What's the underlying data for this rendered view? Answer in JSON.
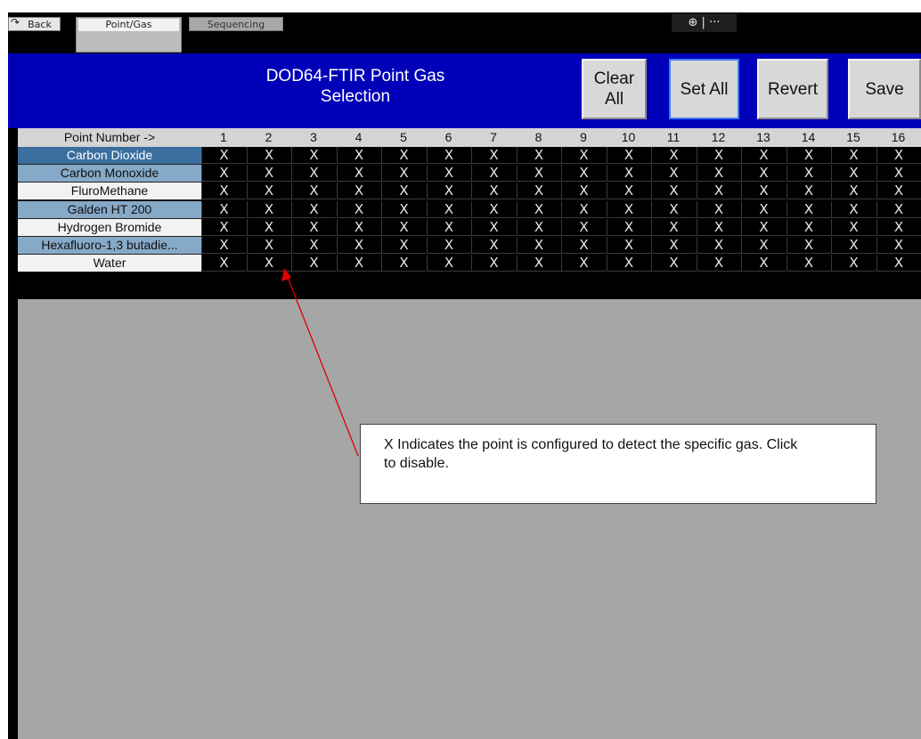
{
  "tabs": {
    "back": "Back",
    "point_gas": "Point/Gas",
    "sequencing": "Sequencing"
  },
  "zoom_controls": {
    "zoom_icon": "zoom-in-icon",
    "separator": "|",
    "more": "···"
  },
  "header": {
    "title_line1": "DOD64-FTIR Point Gas",
    "title_line2": "Selection",
    "clear_line1": "Clear",
    "clear_line2": "All",
    "set_all": "Set All",
    "revert": "Revert",
    "save": "Save",
    "background_color": "#0000b8"
  },
  "grid": {
    "header_label": "Point Number ->",
    "points": [
      "1",
      "2",
      "3",
      "4",
      "5",
      "6",
      "7",
      "8",
      "9",
      "10",
      "11",
      "12",
      "13",
      "14",
      "15",
      "16"
    ],
    "rows": [
      {
        "name": "Carbon Dioxide",
        "bg": "#3a6f9e",
        "fg": "#ffffff"
      },
      {
        "name": "Carbon Monoxide",
        "bg": "#86a9c8",
        "fg": "#111111"
      },
      {
        "name": "FluroMethane",
        "bg": "#f2f2f2",
        "fg": "#111111"
      },
      {
        "name": "Galden HT 200",
        "bg": "#86a9c8",
        "fg": "#111111"
      },
      {
        "name": "Hydrogen Bromide",
        "bg": "#f2f2f2",
        "fg": "#111111"
      },
      {
        "name": "Hexafluoro-1,3 butadie...",
        "bg": "#86a9c8",
        "fg": "#111111"
      },
      {
        "name": "Water",
        "bg": "#f2f2f2",
        "fg": "#111111"
      }
    ],
    "cell_mark": "X"
  },
  "callout": {
    "text": "X Indicates the point is configured to detect the specific gas. Click to disable."
  },
  "colors": {
    "panel_gray": "#a6a6a6",
    "annotation_arrow": "#e00000"
  }
}
